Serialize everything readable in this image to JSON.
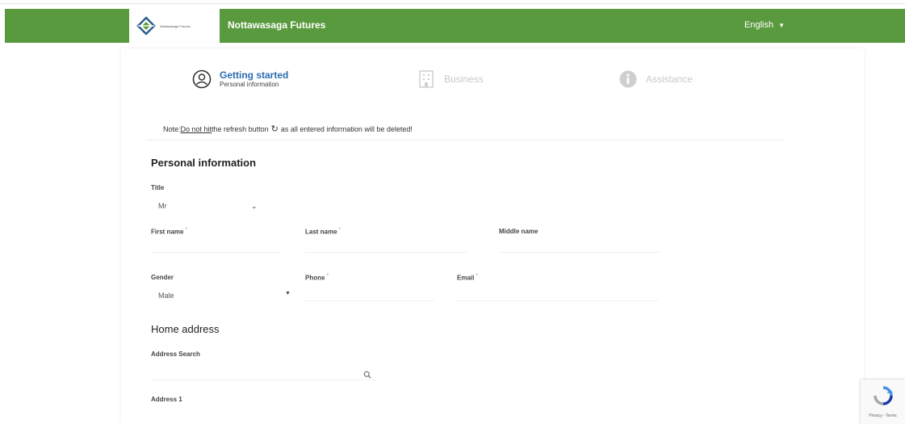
{
  "header": {
    "logo_text": "Nottawasaga Futures",
    "title": "Nottawasaga Futures",
    "language": "English",
    "brand_color": "#5a9a3e"
  },
  "steps": [
    {
      "title": "Getting started",
      "subtitle": "Personal information",
      "icon": "user-circle-icon",
      "active": true
    },
    {
      "title": "Business",
      "subtitle": "",
      "icon": "building-icon",
      "active": false
    },
    {
      "title": "Assistance",
      "subtitle": "",
      "icon": "info-circle-icon",
      "active": false
    }
  ],
  "note": {
    "prefix": "Note: ",
    "emphasis": "Do not hit",
    "middle": " the refresh button",
    "suffix": " as all entered information will be deleted!"
  },
  "personal": {
    "section_title": "Personal information",
    "title_label": "Title",
    "title_value": "Mr",
    "first_name_label": "First name",
    "last_name_label": "Last name",
    "middle_name_label": "Middle name",
    "gender_label": "Gender",
    "gender_value": "Male",
    "phone_label": "Phone",
    "email_label": "Email",
    "required_marker": "*"
  },
  "address": {
    "section_title": "Home address",
    "search_label": "Address Search",
    "address1_label": "Address 1"
  },
  "recaptcha": {
    "links": "Privacy - Terms"
  }
}
